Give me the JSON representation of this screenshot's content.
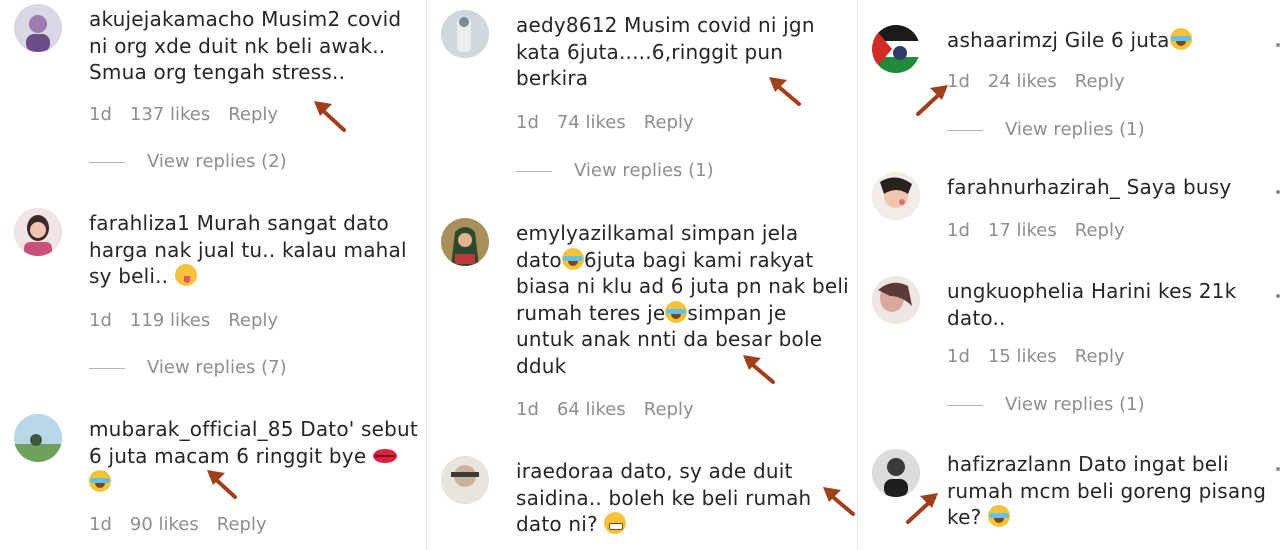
{
  "colors": {
    "arrow": "#a0401a",
    "muted": "#8e8e8e",
    "text": "#262626"
  },
  "columns": [
    {
      "comments": [
        {
          "username": "akujejakamacho",
          "text": "Musim2 covid ni org xde duit nk beli awak.. Smua org tengah stress..",
          "time": "1d",
          "likes": "137 likes",
          "reply": "Reply",
          "view_replies": "View replies (2)"
        },
        {
          "username": "farahliza1",
          "text": "Murah sangat dato harga nak jual tu.. kalau mahal sy beli..",
          "emoji": "face-with-tongue-emoji",
          "time": "1d",
          "likes": "119 likes",
          "reply": "Reply",
          "view_replies": "View replies (7)"
        },
        {
          "username": "mubarak_official_85",
          "text": "Dato' sebut 6 juta macam 6 ringgit bye",
          "emoji": "kiss-lips-emoji, tears-of-joy-emoji",
          "time": "1d",
          "likes": "90 likes",
          "reply": "Reply"
        }
      ]
    },
    {
      "comments": [
        {
          "username": "aedy8612",
          "text": "Musim covid ni jgn kata 6juta.....6,ringgit pun berkira",
          "time": "1d",
          "likes": "74 likes",
          "reply": "Reply",
          "view_replies": "View replies (1)"
        },
        {
          "username": "emylyazilkamal",
          "text_a": "simpan jela dato",
          "text_b": "6juta bagi kami rakyat biasa ni klu ad 6 juta pn nak beli rumah teres je",
          "text_c": "simpan je untuk anak nnti da besar bole dduk",
          "time": "1d",
          "likes": "64 likes",
          "reply": "Reply"
        },
        {
          "username": "iraedoraa",
          "text": "dato, sy ade duit saidina.. boleh ke beli rumah dato ni?",
          "emoji": "grimacing-face-emoji"
        }
      ]
    },
    {
      "comments": [
        {
          "username": "ashaarimzj",
          "text": "Gile 6 juta",
          "emoji": "tears-of-joy-emoji",
          "time": "1d",
          "likes": "24 likes",
          "reply": "Reply",
          "view_replies": "View replies (1)"
        },
        {
          "username": "farahnurhazirah_",
          "text": "Saya busy",
          "time": "1d",
          "likes": "17 likes",
          "reply": "Reply"
        },
        {
          "username": "ungkuophelia",
          "text": "Harini kes 21k dato..",
          "time": "1d",
          "likes": "15 likes",
          "reply": "Reply",
          "view_replies": "View replies (1)"
        },
        {
          "username": "hafizrazlann",
          "text": "Dato ingat beli rumah mcm beli goreng pisang ke?",
          "emoji": "tears-of-joy-emoji"
        }
      ]
    }
  ]
}
